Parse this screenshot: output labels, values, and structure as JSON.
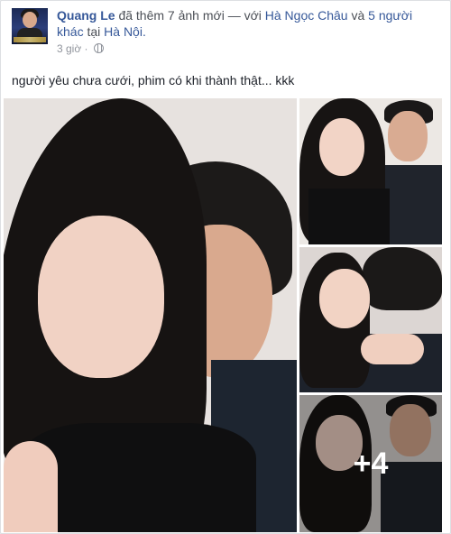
{
  "post": {
    "author": "Quang Le",
    "action_text": " đã thêm 7 ảnh mới — với ",
    "tagged_person": "Hà Ngọc Châu",
    "and_text": " và ",
    "others": "5 người khác",
    "at_text": " tại ",
    "location": "Hà Nội.",
    "time": "3 giờ",
    "privacy_icon": "globe-icon",
    "message": "người yêu chưa cưới, phim có khi thành thật... kkk",
    "more_photos_label": "+4"
  },
  "colors": {
    "link": "#365899",
    "meta": "#90949c",
    "text": "#1d2129"
  }
}
